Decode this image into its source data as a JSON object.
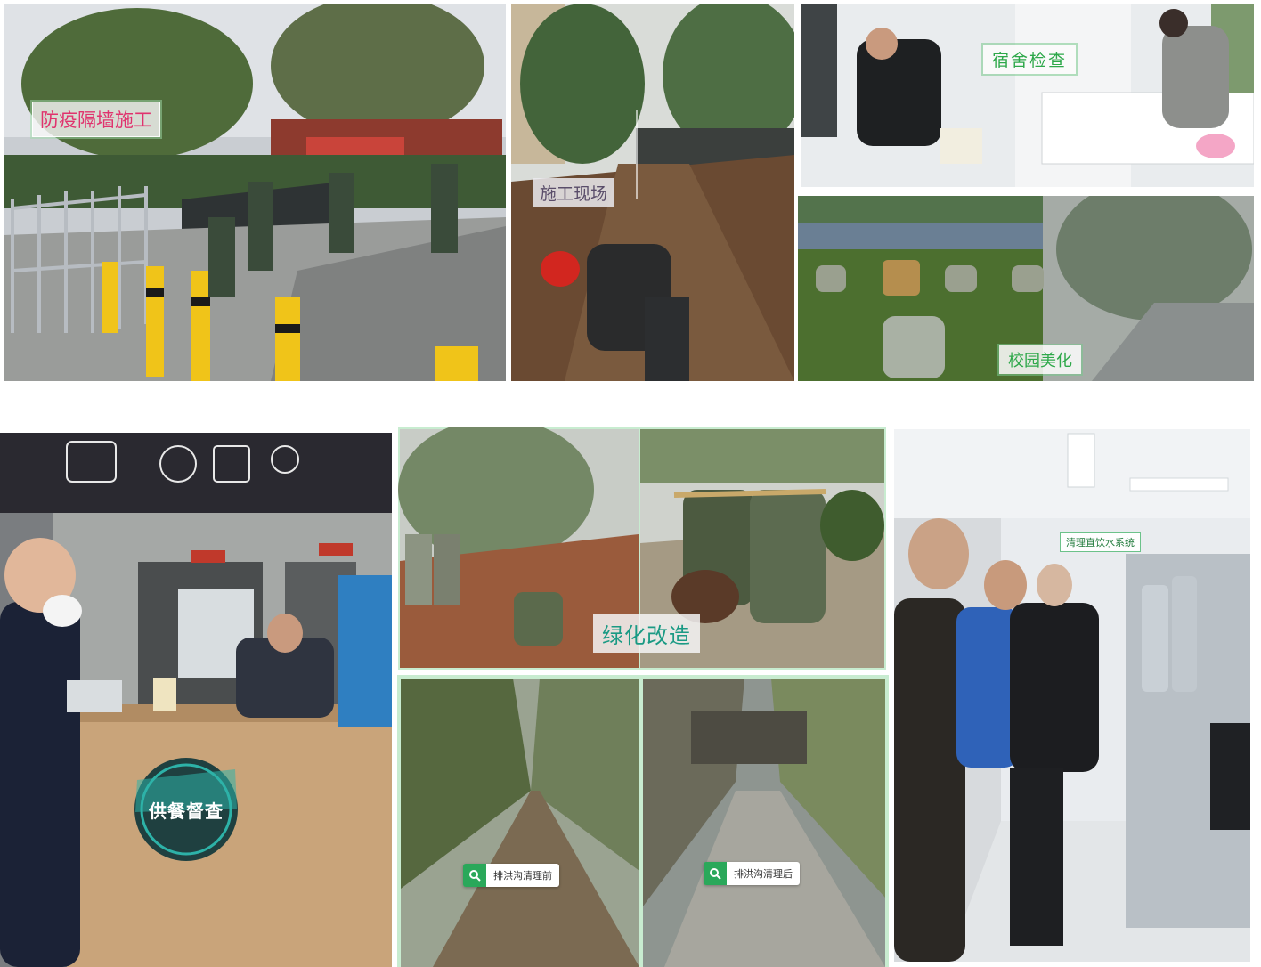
{
  "photos": {
    "fence": {
      "caption": "防疫隔墙施工",
      "icon": "construction-scene"
    },
    "site": {
      "caption": "施工现场",
      "icon": "trench-scene"
    },
    "dorm": {
      "caption": "宿舍检查",
      "icon": "dormitory-scene"
    },
    "campus": {
      "caption": "校园美化",
      "icon": "lawn-scene"
    },
    "canteen": {
      "caption": "供餐督查",
      "icon": "canteen-scene"
    },
    "greening": {
      "caption": "绿化改造",
      "icon": "tree-planting-scene"
    },
    "ditch_before": {
      "caption": "排洪沟清理前",
      "icon": "search-icon"
    },
    "ditch_after": {
      "caption": "排洪沟清理后",
      "icon": "search-icon"
    },
    "water": {
      "caption": "清理直饮水系统",
      "icon": "water-system-scene"
    }
  },
  "colors": {
    "pink_caption": "#e0336e",
    "green_caption": "#2ea84a",
    "teal_caption": "#1a9a84",
    "search_green": "#2aa85a",
    "frame_green": "#9ad8a8"
  }
}
